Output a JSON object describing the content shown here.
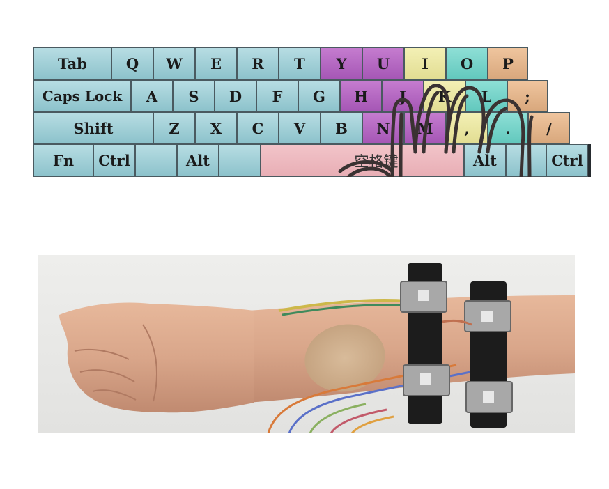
{
  "keyboard": {
    "row1": [
      "Tab",
      "Q",
      "W",
      "E",
      "R",
      "T",
      "Y",
      "U",
      "I",
      "O",
      "P"
    ],
    "row2": [
      "Caps Lock",
      "A",
      "S",
      "D",
      "F",
      "G",
      "H",
      "J",
      "K",
      "L",
      ";"
    ],
    "row3": [
      "Shift",
      "Z",
      "X",
      "C",
      "V",
      "B",
      "N",
      "M",
      ",",
      ".",
      "/"
    ],
    "row4": [
      "Fn",
      "Ctrl",
      "",
      "Alt",
      "",
      "空格键",
      "Alt",
      "",
      "Ctrl"
    ]
  },
  "colors": {
    "key_cyan": "#a2d0d8",
    "key_purple": "#b466c2",
    "key_yellow": "#ece7a3",
    "key_teal": "#78d4ca",
    "key_tan": "#e4b68d",
    "key_pink": "#eebabf",
    "skin": "#d9a98c",
    "band": "#1c1c1c"
  }
}
